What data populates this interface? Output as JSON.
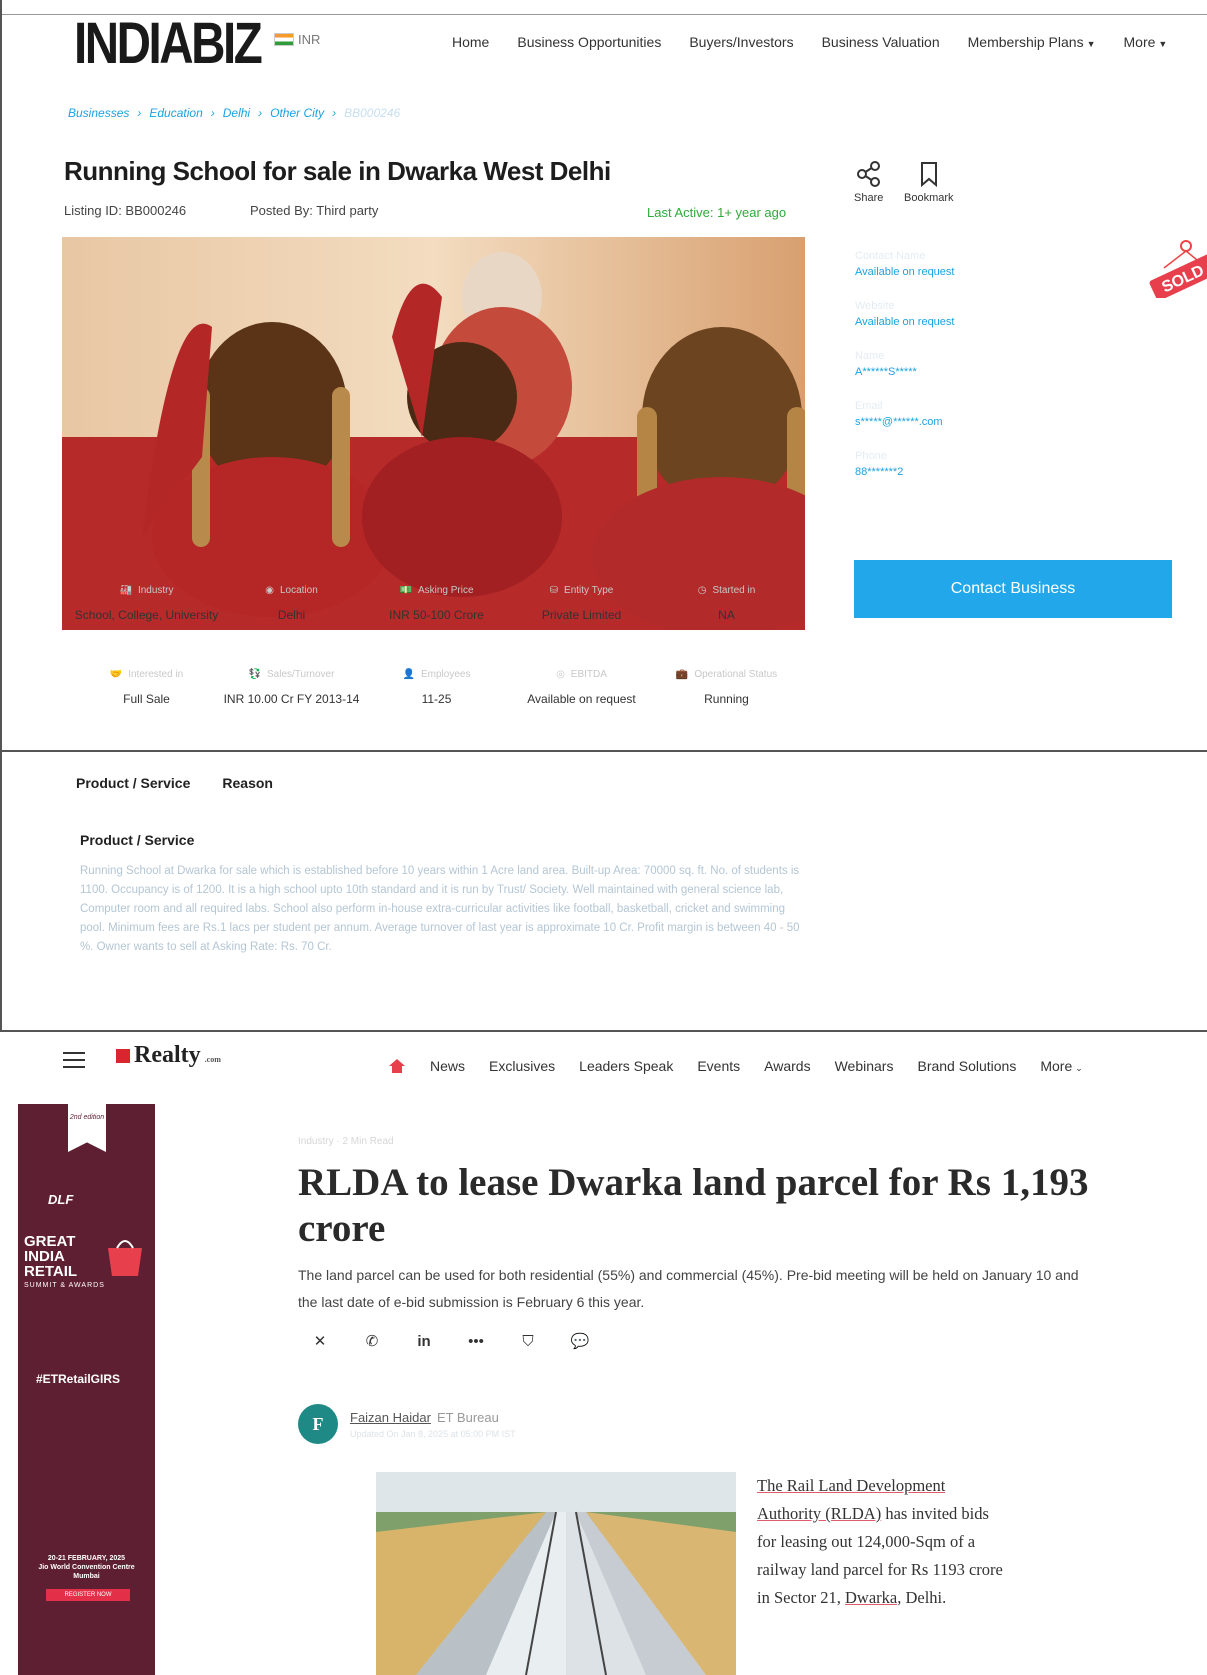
{
  "listing": {
    "logo": "INDIABIZ",
    "currency": "INR",
    "nav": [
      "Home",
      "Business Opportunities",
      "Buyers/Investors",
      "Business Valuation",
      "Membership Plans",
      "More"
    ],
    "breadcrumbs": [
      "Businesses",
      "Education",
      "Delhi",
      "Other City",
      "BB000246"
    ],
    "title": "Running School for sale in Dwarka West Delhi",
    "listing_id": "Listing ID: BB000246",
    "posted_by": "Posted By: Third party",
    "last_active": "Last Active: 1+ year ago",
    "share_label": "Share",
    "bookmark_label": "Bookmark",
    "sold_badge": "SOLD",
    "contact_fields": [
      {
        "label": "Contact Name",
        "value": "Available on request"
      },
      {
        "label": "Website",
        "value": "Available on request"
      },
      {
        "label": "Name",
        "value": "A******S*****"
      },
      {
        "label": "Email",
        "value": "s*****@******.com"
      },
      {
        "label": "Phone",
        "value": "88*******2"
      }
    ],
    "contact_button": "Contact Business",
    "facts_row1": [
      {
        "label": "Industry",
        "value": "School, College, University"
      },
      {
        "label": "Location",
        "value": "Delhi"
      },
      {
        "label": "Asking Price",
        "value": "INR 50-100 Crore"
      },
      {
        "label": "Entity Type",
        "value": "Private Limited"
      },
      {
        "label": "Started in",
        "value": "NA"
      }
    ],
    "facts_row2": [
      {
        "label": "Interested in",
        "value": "Full Sale"
      },
      {
        "label": "Sales/Turnover",
        "value": "INR 10.00 Cr FY 2013-14"
      },
      {
        "label": "Employees",
        "value": "11-25"
      },
      {
        "label": "EBITDA",
        "value": "Available on request"
      },
      {
        "label": "Operational Status",
        "value": "Running"
      }
    ]
  },
  "details": {
    "tabs": [
      "Product / Service",
      "Reason"
    ],
    "section_title": "Product / Service",
    "description": "Running School at Dwarka for sale which is established before 10 years within 1 Acre land area. Built-up Area: 70000 sq. ft. No. of students is 1100. Occupancy is of 1200. It is a high school upto 10th standard and it is run by Trust/ Society. Well maintained with general science lab, Computer room and all required labs. School also perform in-house extra-curricular activities like football, basketball, cricket and swimming pool. Minimum fees are Rs.1 lacs per student per annum. Average turnover of last year is approximate 10 Cr. Profit margin is between 40 - 50 %. Owner wants to sell at Asking Rate: Rs. 70 Cr."
  },
  "news": {
    "logo": "Realty",
    "logo_suffix": ".com",
    "nav": [
      "News",
      "Exclusives",
      "Leaders Speak",
      "Events",
      "Awards",
      "Webinars",
      "Brand Solutions",
      "More"
    ],
    "ad": {
      "edition": "2nd edition",
      "sponsor": "DLF",
      "title_lines": [
        "GREAT",
        "INDIA",
        "RETAIL"
      ],
      "subtitle": "SUMMIT & AWARDS",
      "hashtag": "#ETRetailGIRS",
      "date": "20-21 FEBRUARY, 2025",
      "venue": "Jio World Convention Centre",
      "city": "Mumbai",
      "cta": "REGISTER NOW"
    },
    "kicker": "Industry · 2 Min Read",
    "headline": "RLDA to lease Dwarka land parcel for Rs 1,193 crore",
    "summary": "The land parcel can be used for both residential (55%) and commercial (45%). Pre-bid meeting will be held on January 10 and the last date of e-bid submission is February 6 this year.",
    "share_icons": [
      "X",
      "WhatsApp",
      "in",
      "•••",
      "bookmark",
      "comment"
    ],
    "author_initial": "F",
    "author": "Faizan Haidar",
    "bureau": "ET Bureau",
    "updated": "Updated On Jan 8, 2025 at 05:00 PM IST",
    "body_line1": "The Rail Land Development",
    "body_line2": "Authority (RLDA)",
    "body_rest": "has invited bids for leasing out 124,000-Sqm of a railway land parcel for Rs 1193 crore in Sector 21, ",
    "body_link": "Dwarka",
    "body_end": ", Delhi."
  }
}
